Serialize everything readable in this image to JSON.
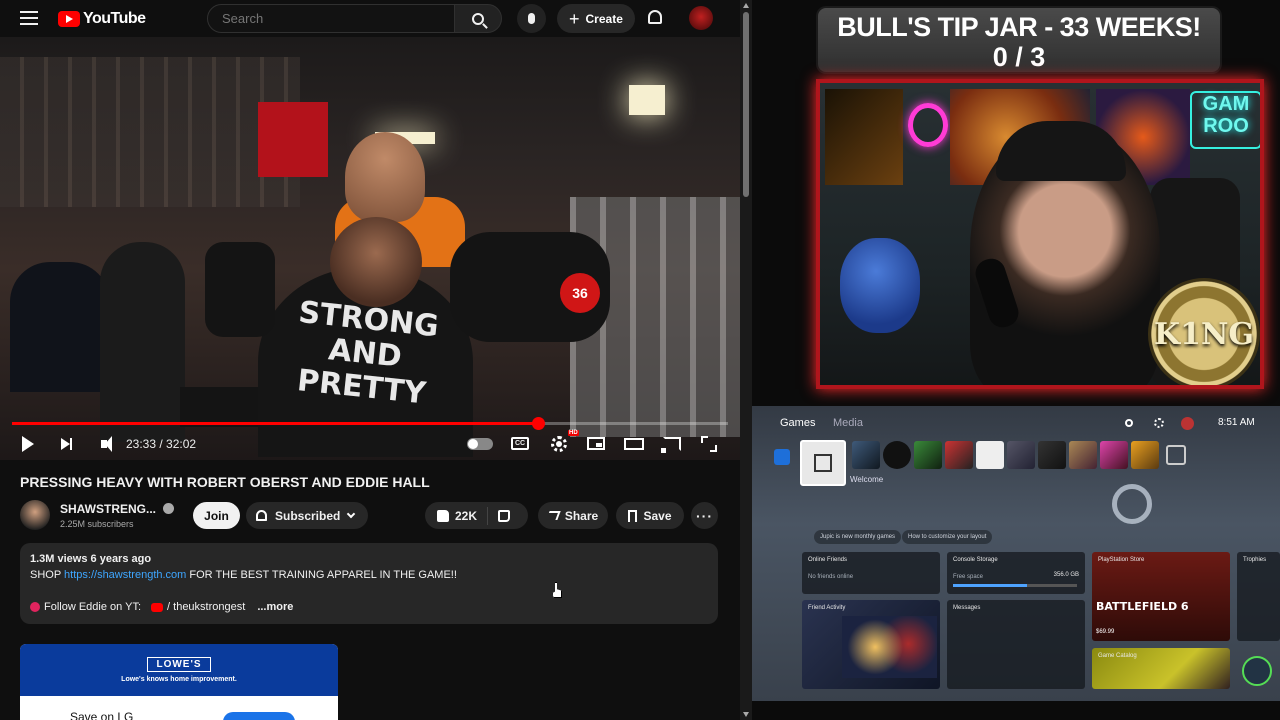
{
  "youtube": {
    "logo_text": "YouTube",
    "search_placeholder": "Search",
    "create_label": "Create",
    "player": {
      "time": "23:33 / 32:02",
      "progress": 0.735,
      "cc_label": "CC",
      "hd_badge": "HD",
      "shirt_text": "STRONG\nAND\nPRETTY",
      "dumbbell_label": "36"
    },
    "title": "PRESSING HEAVY WITH ROBERT OBERST AND EDDIE HALL",
    "channel": {
      "name": "SHAWSTRENG...",
      "subscribers": "2.25M subscribers"
    },
    "join_label": "Join",
    "subscribed_label": "Subscribed",
    "likes": "22K",
    "share_label": "Share",
    "save_label": "Save",
    "more_label": "···",
    "description": {
      "meta": "1.3M views  6 years ago",
      "shop_prefix": "SHOP",
      "link": "https://shawstrength.com",
      "shop_suffix": "FOR THE BEST TRAINING APPAREL IN THE GAME!!",
      "follow_label": "Follow Eddie on YT:",
      "handle": "/ theukstrongest",
      "more": "...more"
    },
    "ad": {
      "logo": "LOWE'S",
      "tagline": "Lowe's knows home improvement.",
      "cta_text": "Save on LG"
    }
  },
  "stream": {
    "tip_title": "BULL'S TIP JAR - 33 WEEKS!",
    "tip_count": "0 / 3",
    "neon_sign": "GAM\nROO",
    "badge": "K1NG",
    "ps5": {
      "tabs": [
        "Games",
        "Media"
      ],
      "time": "8:51 AM",
      "welcome": "Welcome",
      "pills": [
        "Jupic is new monthly games",
        "How to customize your layout"
      ],
      "cards": {
        "online_friends": {
          "title": "Online Friends",
          "body": "No friends online"
        },
        "console_storage": {
          "title": "Console Storage",
          "body": "Free space",
          "value": "356.0 GB",
          "fill": 0.6
        },
        "store": {
          "title": "PlayStation Store",
          "game": "BATTLEFIELD 6",
          "price": "$69.99"
        },
        "friend_activity": {
          "title": "Friend Activity"
        },
        "messages": {
          "title": "Messages"
        },
        "catalog": {
          "title": "Game Catalog"
        },
        "trophies": {
          "title": "Trophies"
        }
      }
    }
  }
}
